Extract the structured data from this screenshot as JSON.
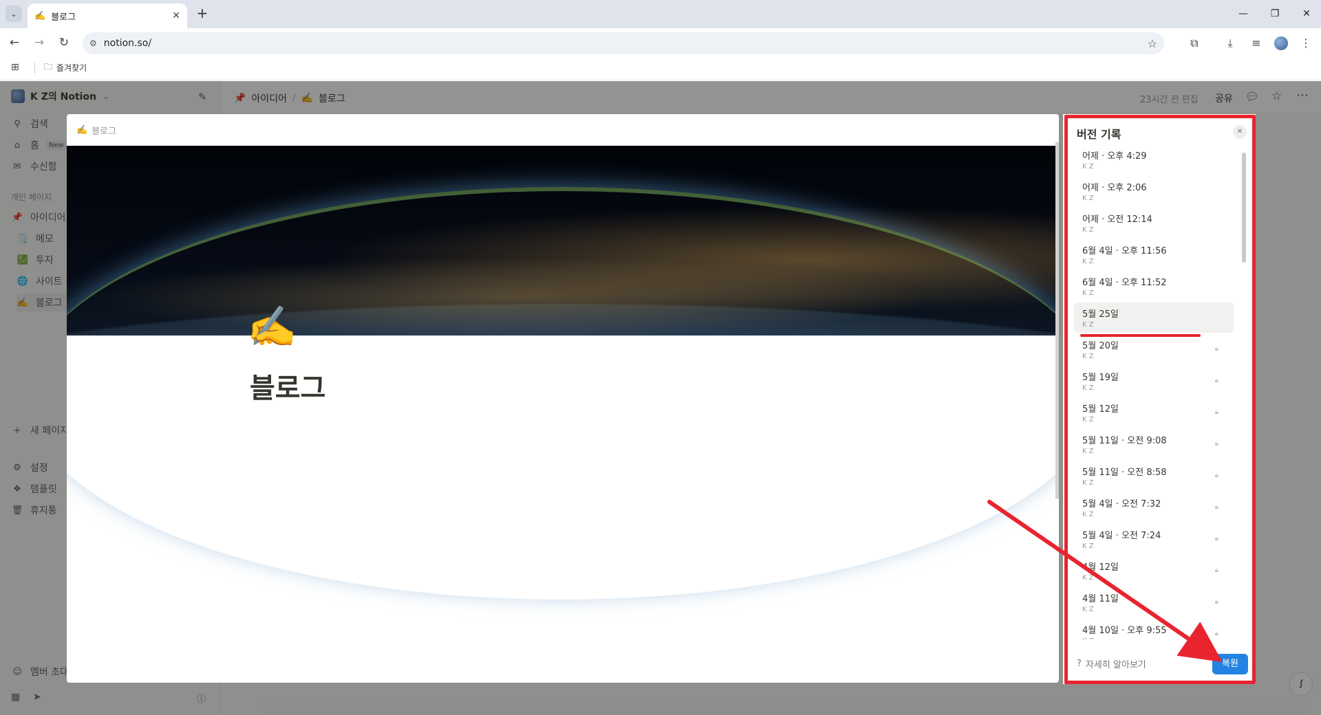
{
  "browser": {
    "tab_title": "블로그",
    "tab_emoji": "✍️",
    "url": "notion.so/",
    "bookmark_label": "즐겨찾기"
  },
  "workspace": {
    "name": "K Z의 Notion"
  },
  "sidebar": {
    "items": [
      {
        "icon": "search-icon",
        "label": "검색"
      },
      {
        "icon": "home-icon",
        "label": "홈",
        "badge": "New"
      },
      {
        "icon": "inbox-icon",
        "label": "수신함"
      }
    ],
    "section_label": "개인 페이지",
    "pages": [
      {
        "emoji": "📌",
        "label": "아이디어"
      },
      {
        "emoji": "🗒️",
        "label": "메모"
      },
      {
        "emoji": "💹",
        "label": "투자"
      },
      {
        "emoji": "🌐",
        "label": "사이트"
      },
      {
        "emoji": "✍️",
        "label": "블로그"
      }
    ],
    "new_page": "새 페이지",
    "bottom": [
      {
        "icon": "gear-icon",
        "label": "설정"
      },
      {
        "icon": "template-icon",
        "label": "템플릿"
      },
      {
        "icon": "trash-icon",
        "label": "휴지통"
      }
    ],
    "invite": "멤버 초대"
  },
  "topbar": {
    "breadcrumb": [
      {
        "emoji": "📌",
        "label": "아이디어"
      },
      {
        "emoji": "✍️",
        "label": "블로그"
      }
    ],
    "edited": "23시간 전 편집",
    "share": "공유"
  },
  "modal": {
    "header_emoji": "✍️",
    "header_title": "블로그",
    "page_emoji": "✍️",
    "page_title": "블로그"
  },
  "version_panel": {
    "title": "버전 기록",
    "versions": [
      {
        "date": "어제 · 오후 4:29",
        "user": "K Z",
        "locked": false
      },
      {
        "date": "어제 · 오후 2:06",
        "user": "K Z",
        "locked": false
      },
      {
        "date": "어제 · 오전 12:14",
        "user": "K Z",
        "locked": false
      },
      {
        "date": "6월 4일 · 오후 11:56",
        "user": "K Z",
        "locked": false
      },
      {
        "date": "6월 4일 · 오후 11:52",
        "user": "K Z",
        "locked": false
      },
      {
        "date": "5월 25일",
        "user": "K Z",
        "locked": false,
        "selected": true
      },
      {
        "date": "5월 20일",
        "user": "K Z",
        "locked": true
      },
      {
        "date": "5월 19일",
        "user": "K Z",
        "locked": true
      },
      {
        "date": "5월 12일",
        "user": "K Z",
        "locked": true
      },
      {
        "date": "5월 11일 · 오전 9:08",
        "user": "K Z",
        "locked": true
      },
      {
        "date": "5월 11일 · 오전 8:58",
        "user": "K Z",
        "locked": true
      },
      {
        "date": "5월 4일 · 오전 7:32",
        "user": "K Z",
        "locked": true
      },
      {
        "date": "5월 4일 · 오전 7:24",
        "user": "K Z",
        "locked": true
      },
      {
        "date": "4월 12일",
        "user": "K Z",
        "locked": true
      },
      {
        "date": "4월 11일",
        "user": "K Z",
        "locked": true
      },
      {
        "date": "4월 10일 · 오후 9:55",
        "user": "K Z",
        "locked": true
      }
    ],
    "learn_more": "자세히 알아보기",
    "restore": "복원"
  },
  "colors": {
    "annotation_red": "#e8242f",
    "accent_blue": "#2383e2"
  }
}
